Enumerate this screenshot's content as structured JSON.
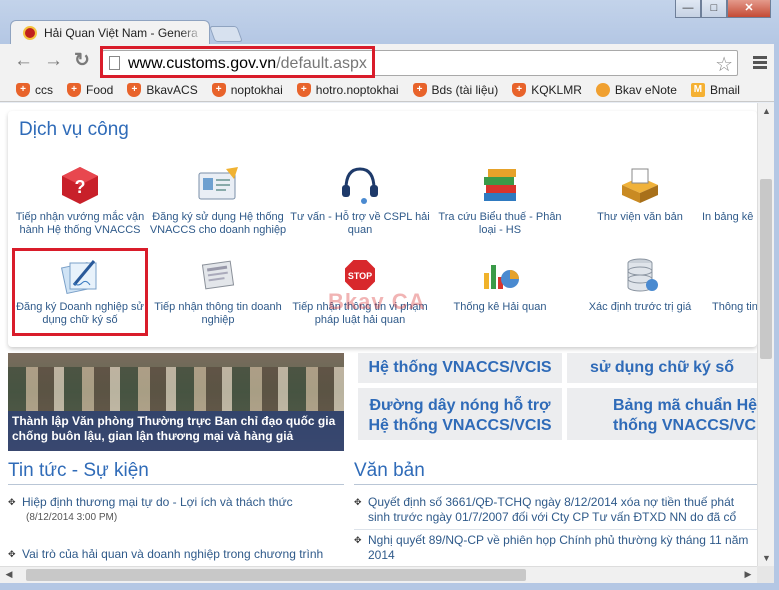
{
  "window": {
    "tab_title": "Hải Quan Việt Nam - Genera",
    "minimize": "—",
    "maximize": "□",
    "close": "✕"
  },
  "toolbar": {
    "back": "←",
    "forward": "→",
    "reload": "↻",
    "url_host": "www.customs.gov.vn",
    "url_path": "/default.aspx",
    "star": "☆"
  },
  "bookmarks": [
    {
      "label": "ccs",
      "icon": "shield-bookmark-icon"
    },
    {
      "label": "Food",
      "icon": "shield-bookmark-icon"
    },
    {
      "label": "BkavACS",
      "icon": "shield-bookmark-icon"
    },
    {
      "label": "noptokhai",
      "icon": "shield-bookmark-icon"
    },
    {
      "label": "hotro.noptokhai",
      "icon": "shield-bookmark-icon"
    },
    {
      "label": "Bds (tài liệu)",
      "icon": "shield-bookmark-icon"
    },
    {
      "label": "KQKLMR",
      "icon": "shield-bookmark-icon"
    },
    {
      "label": "Bkav eNote",
      "icon": "bird-bookmark-icon"
    },
    {
      "label": "Bmail",
      "icon": "mail-bookmark-icon"
    }
  ],
  "services": {
    "title": "Dịch vụ công",
    "row1": [
      {
        "label": "Tiếp nhận vướng mắc vận hành Hệ thống VNACCS",
        "icon": "question-cube-icon"
      },
      {
        "label": "Đăng ký sử dụng Hệ thống VNACCS cho doanh nghiệp",
        "icon": "id-card-icon"
      },
      {
        "label": "Tư vấn - Hỗ trợ về CSPL hải quan",
        "icon": "headset-icon"
      },
      {
        "label": "Tra cứu Biểu thuế - Phân loại - HS",
        "icon": "books-icon"
      },
      {
        "label": "Thư viện văn bản",
        "icon": "document-box-icon"
      },
      {
        "label": "In bảng kê nộp tiền",
        "icon": "print-icon"
      }
    ],
    "row2": [
      {
        "label": "Đăng ký Doanh nghiệp sử dụng chữ ký số",
        "icon": "signature-pen-icon"
      },
      {
        "label": "Tiếp nhận thông tin doanh nghiệp",
        "icon": "newspaper-icon"
      },
      {
        "label": "Tiếp nhận thông tin vi phạm pháp luật hải quan",
        "icon": "stop-sign-icon"
      },
      {
        "label": "Thống kê Hải quan",
        "icon": "chart-icon"
      },
      {
        "label": "Xác định trước trị giá",
        "icon": "database-icon"
      },
      {
        "label": "Thông tin",
        "icon": "info-icon"
      }
    ]
  },
  "watermark": "Bkav CA",
  "photo_caption": "Thành lập Văn phòng Thường trực Ban chỉ đạo quốc gia chống buôn lậu, gian lận thương mại và hàng giả",
  "quicklinks": {
    "top_left": "Hệ thống VNACCS/VCIS",
    "top_right": "sử dụng chữ ký số",
    "hotline": "Đường dây nóng hỗ trợ Hệ thống VNACCS/VCIS",
    "code_table": "Bảng mã chuẩn Hệ thống VNACCS/VCIS"
  },
  "news": {
    "title": "Tin tức - Sự kiện",
    "items": [
      {
        "text": "Hiệp định thương mại tự do - Lợi ích và thách thức",
        "date": "(8/12/2014 3:00 PM)"
      },
      {
        "text": "Vai trò của hải quan và doanh nghiệp trong chương trình",
        "date": ""
      }
    ]
  },
  "documents": {
    "title": "Văn bản",
    "items": [
      {
        "text": "Quyết định số 3661/QĐ-TCHQ ngày 8/12/2014 xóa nợ tiền thuế phát sinh trước ngày 01/7/2007 đối với Cty CP Tư vấn ĐTXD NN do đã cổ phần hóa"
      },
      {
        "text": "Nghị quyết 89/NQ-CP về phiên họp Chính phủ thường kỳ tháng 11 năm 2014"
      }
    ]
  }
}
